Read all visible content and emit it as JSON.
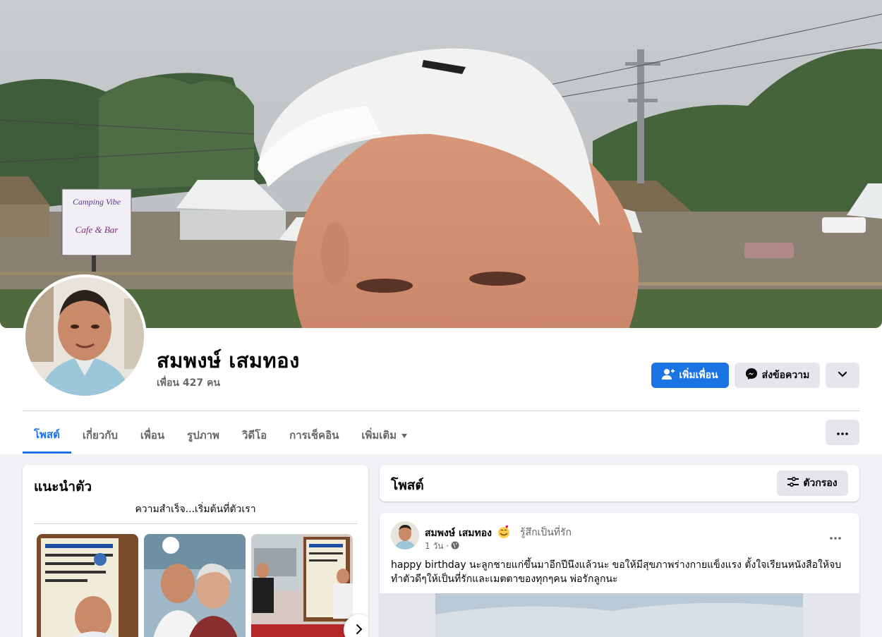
{
  "profile": {
    "name": "สมพงษ์ เสมทอง",
    "friends_count": "เพื่อน 427 คน"
  },
  "actions": {
    "add_friend": "เพิ่มเพื่อน",
    "message": "ส่งข้อความ"
  },
  "tabs": [
    {
      "label": "โพสต์",
      "active": true
    },
    {
      "label": "เกี่ยวกับ",
      "active": false
    },
    {
      "label": "เพื่อน",
      "active": false
    },
    {
      "label": "รูปภาพ",
      "active": false
    },
    {
      "label": "วิดีโอ",
      "active": false
    },
    {
      "label": "การเช็คอิน",
      "active": false
    },
    {
      "label": "เพิ่มเติม",
      "active": false
    }
  ],
  "intro": {
    "title": "แนะนำตัว",
    "bio": "ความสำเร็จ...เริ่มต้นที่ตัวเรา"
  },
  "cover_sign": {
    "line1": "Camping Vibe",
    "line2": "Cafe & Bar"
  },
  "posts": {
    "title": "โพสต์",
    "filter_label": "ตัวกรอง",
    "items": [
      {
        "author": "สมพงษ์ เสมทอง",
        "feeling": "รู้สึกเป็นที่รัก",
        "time": "1 วัน ·",
        "text": "happy birthday นะลูกชายแก่ขึ้นมาอีกปีนึงแล้วนะ ขอให้มีสุขภาพร่างกายแข็งแรง ตั้งใจเรียนหนังสือให้จบ ทำตัวดีๆให้เป็นที่รักและเมตตาของทุกๆคน พ่อรักลูกนะ"
      }
    ]
  },
  "colors": {
    "accent": "#1b74e4",
    "background": "#f0f2f5",
    "secondary_button": "#e4e6eb",
    "muted_text": "#65676b"
  },
  "icons": [
    "add-friend-icon",
    "messenger-icon",
    "chevron-down-icon",
    "more-dots-icon",
    "filter-icon",
    "globe-icon",
    "love-emoji-icon",
    "chevron-right-icon"
  ]
}
